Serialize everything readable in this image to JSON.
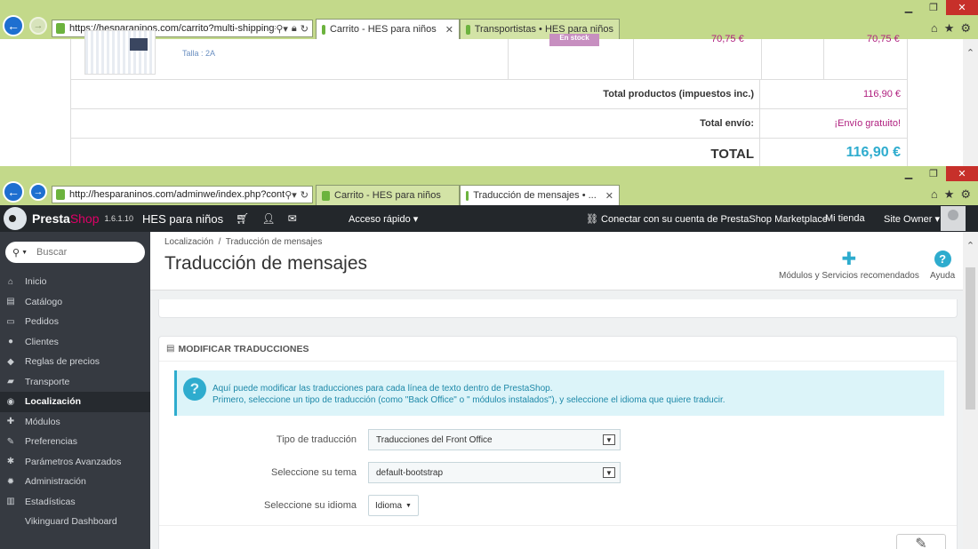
{
  "window_top": {
    "address": "https://hesparaninos.com/carrito?multi-shipping=",
    "tabs": [
      {
        "label": "Carrito - HES para niños",
        "active": true
      },
      {
        "label": "Transportistas • HES para niños",
        "active": false
      }
    ],
    "cart": {
      "size_label": "Talla : 2A",
      "stock_badge": "En stock",
      "unit_price": "70,75 €",
      "line_total": "70,75 €",
      "rows": [
        {
          "label": "Total productos (impuestos inc.)",
          "value": "116,90 €"
        },
        {
          "label": "Total envío:",
          "value": "¡Envío gratuito!"
        },
        {
          "label": "TOTAL",
          "value": "116,90 €"
        }
      ]
    }
  },
  "window_bottom": {
    "address": "http://hesparaninos.com/adminwe/index.php?control",
    "tabs": [
      {
        "label": "Carrito - HES para niños",
        "active": false
      },
      {
        "label": "Traducción de mensajes • ...",
        "active": true
      }
    ],
    "topbar": {
      "brand_presta": "Presta",
      "brand_shop": "Shop",
      "version": "1.6.1.10",
      "shop_name": "HES para niños",
      "quick_access": "Acceso rápido ▾",
      "connect": "Conectar con su cuenta de PrestaShop Marketplace",
      "my_shop": "Mi tienda",
      "owner": "Site Owner ▾"
    },
    "sidebar": {
      "search_placeholder": "Buscar",
      "items": [
        {
          "label": "Inicio",
          "icon": "home-icon",
          "glyph": "⌂"
        },
        {
          "label": "Catálogo",
          "icon": "book-icon",
          "glyph": "▤"
        },
        {
          "label": "Pedidos",
          "icon": "credit-card-icon",
          "glyph": "▭"
        },
        {
          "label": "Clientes",
          "icon": "users-icon",
          "glyph": "●"
        },
        {
          "label": "Reglas de precios",
          "icon": "tag-icon",
          "glyph": "◆"
        },
        {
          "label": "Transporte",
          "icon": "truck-icon",
          "glyph": "▰"
        },
        {
          "label": "Localización",
          "icon": "globe-icon",
          "glyph": "◉"
        },
        {
          "label": "Módulos",
          "icon": "puzzle-icon",
          "glyph": "✚"
        },
        {
          "label": "Preferencias",
          "icon": "wrench-icon",
          "glyph": "✎"
        },
        {
          "label": "Parámetros Avanzados",
          "icon": "cogs-icon",
          "glyph": "✱"
        },
        {
          "label": "Administración",
          "icon": "gear-icon",
          "glyph": "✹"
        },
        {
          "label": "Estadísticas",
          "icon": "bar-chart-icon",
          "glyph": "▥"
        },
        {
          "label": "Vikinguard Dashboard",
          "icon": "",
          "glyph": ""
        }
      ]
    },
    "page": {
      "breadcrumb_1": "Localización",
      "breadcrumb_sep": "/",
      "breadcrumb_2": "Traducción de mensajes",
      "title": "Traducción de mensajes",
      "toolbar_modules": "Módulos y Servicios recomendados",
      "toolbar_help": "Ayuda",
      "panel_title": "Modificar traducciones",
      "alert_line1": "Aquí puede modificar las traducciones para cada línea de texto dentro de PrestaShop.",
      "alert_line2": "Primero, seleccione un tipo de traducción (como \"Back Office\" o \" módulos instalados\"), y seleccione el idioma que quiere traducir.",
      "form": {
        "type_label": "Tipo de traducción",
        "type_value": "Traducciones del Front Office",
        "theme_label": "Seleccione su tema",
        "theme_value": "default-bootstrap",
        "lang_label": "Seleccione su idioma",
        "lang_value": "Idioma"
      }
    }
  },
  "colors": {
    "chrome": "#c3d98a",
    "admin_topbar": "#23272b",
    "sidebar": "#363a41",
    "accent": "#2eacce",
    "price": "#b0207f",
    "brand_pink": "#df0067"
  }
}
